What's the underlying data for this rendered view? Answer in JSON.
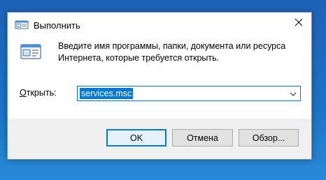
{
  "window": {
    "title": "Выполнить"
  },
  "description": {
    "line1": "Введите имя программы, папки, документа или ресурса",
    "line2": "Интернета, которые требуется открыть."
  },
  "open_field": {
    "label_accel": "О",
    "label_rest": "ткрыть:",
    "value": "services.msc"
  },
  "buttons": {
    "ok": "OK",
    "cancel": "Отмена",
    "browse": "Обзор..."
  },
  "icons": {
    "title": "run-icon",
    "close": "close-icon",
    "dropdown": "chevron-down-icon",
    "dialog": "run-icon"
  },
  "colors": {
    "accent": "#0078d7",
    "footer_bg": "#f0f0f0",
    "button_bg": "#e1e1e1"
  }
}
